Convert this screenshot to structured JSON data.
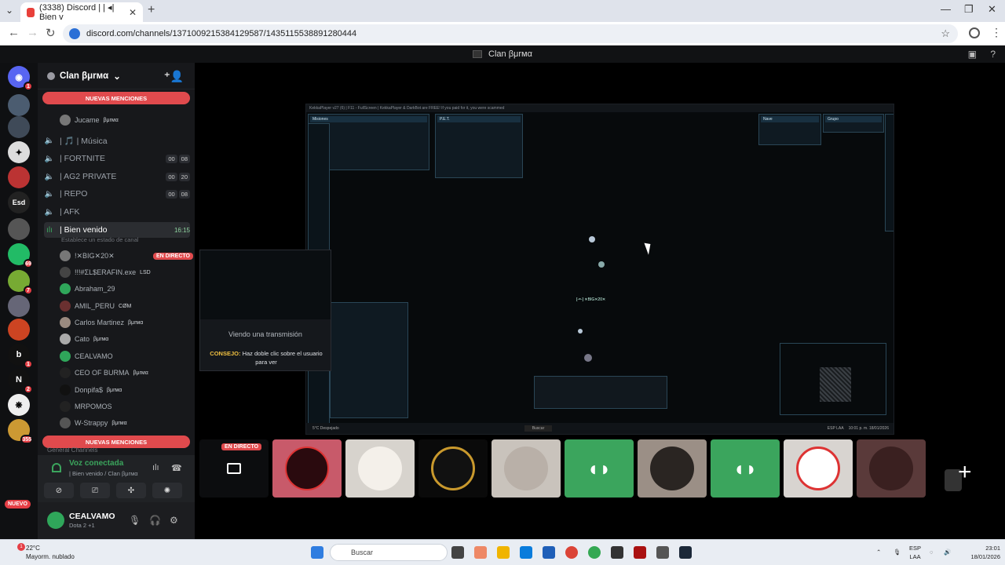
{
  "browser": {
    "tab_title": "(3338) Discord | | ◂| Bien v",
    "address": "discord.com/channels/1371009215384129587/1435115538891280444"
  },
  "window_title": "Clan βμrмα",
  "server": {
    "name": "Clan βμrмα",
    "badges": {
      "top": "1",
      "s69": "69",
      "s7": "7",
      "s355": "355",
      "s1b": "1",
      "s2": "2"
    },
    "esd": "Esd",
    "nuevo": "NUEVO"
  },
  "sidebar": {
    "new_mentions": "NUEVAS MENCIONES",
    "jucame": "Jucame",
    "jucame_tag": "βμrмα",
    "channels": [
      {
        "name": "| 🎵 | Música"
      },
      {
        "name": "| FORTNITE",
        "c1": "00",
        "c2": "08"
      },
      {
        "name": "| AG2 PRIVATE",
        "c1": "00",
        "c2": "20"
      },
      {
        "name": "| REPO",
        "c1": "00",
        "c2": "08"
      },
      {
        "name": "| AFK"
      }
    ],
    "active_channel": "| Bien venido",
    "active_time": "16:15",
    "status_hint": "Establece un estado de canal",
    "users": [
      {
        "name": "!✕BIG✕20✕",
        "live": "EN DIRECTO"
      },
      {
        "name": "!!!#ΣL$ERAFIN.exe",
        "tag": "LSD"
      },
      {
        "name": "Abraham_29"
      },
      {
        "name": "AMIL_PERU",
        "tag": "CØM"
      },
      {
        "name": "Carlos Martinez",
        "tag": "βμrмα"
      },
      {
        "name": "Cato",
        "tag": "βμrмα"
      },
      {
        "name": "CEALVAMO"
      },
      {
        "name": "CEO OF BURMA",
        "tag": "βμrмα"
      },
      {
        "name": "Donpifa$",
        "tag": "βμrмα"
      },
      {
        "name": "MRPOMOS"
      },
      {
        "name": "W-Strappy",
        "tag": "βμrмα"
      }
    ],
    "new_mentions_bottom": "NUEVAS MENCIONES",
    "general": "General Channels"
  },
  "voice": {
    "title": "Voz conectada",
    "sub": "| Bien venido / Clan βμrмα"
  },
  "user_panel": {
    "name": "CEALVAMO",
    "activity": "Dota 2 +1"
  },
  "stream": {
    "top_text": "KekkaPlayer v27 (6) | F11 - FullScreen | KekkaPlayer & DarkBot are FREE! If you paid for it, you were scammed",
    "missions": "Misiones",
    "pet": "P.E.T.",
    "nave": "Nave",
    "grupo": "Grupo",
    "player": "[-=-] ✕BIG✕20✕",
    "input_lang": "ESP\nLAA",
    "inner_time": "10:01 p. m.\n18/01/2026",
    "inner_search": "Buscar",
    "inner_weather": "5°C\nDespejado"
  },
  "preview": {
    "title": "Viendo una transmisión",
    "tip_label": "CONSEJO:",
    "tip_text": "Haz doble clic sobre el usuario para ver"
  },
  "tiles": {
    "live": "EN DIRECTO"
  },
  "taskbar": {
    "temp": "22°C",
    "weather": "Mayorm. nublado",
    "search": "Buscar",
    "lang": "ESP\nLAA",
    "time": "23:01",
    "date": "18/01/2026",
    "badge": "1"
  }
}
